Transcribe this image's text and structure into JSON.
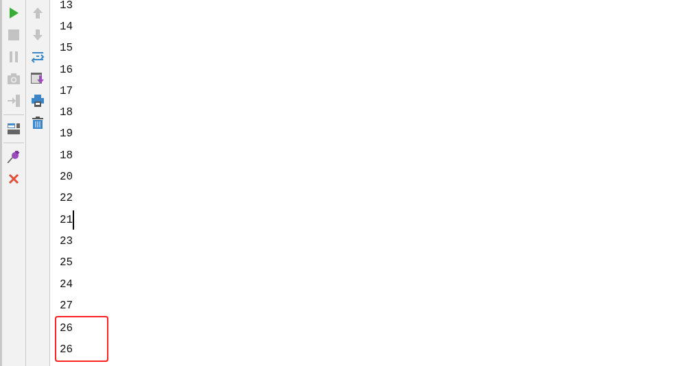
{
  "toolbar_left": [
    {
      "kind": "run",
      "disabled": false
    },
    {
      "kind": "stop",
      "disabled": true
    },
    {
      "kind": "pause",
      "disabled": true
    },
    {
      "kind": "camera",
      "disabled": true
    },
    {
      "kind": "exit",
      "disabled": true
    },
    {
      "kind": "separator"
    },
    {
      "kind": "layout",
      "disabled": false
    },
    {
      "kind": "separator"
    },
    {
      "kind": "pin",
      "disabled": false
    },
    {
      "kind": "close",
      "disabled": false
    }
  ],
  "toolbar_right": [
    {
      "kind": "up",
      "disabled": true
    },
    {
      "kind": "down",
      "disabled": true
    },
    {
      "kind": "wrap",
      "disabled": false
    },
    {
      "kind": "scroll-end",
      "disabled": false
    },
    {
      "kind": "print",
      "disabled": false
    },
    {
      "kind": "trash",
      "disabled": false
    }
  ],
  "console_lines": [
    {
      "text": "13",
      "cursor": false,
      "highlighted": false
    },
    {
      "text": "14",
      "cursor": false,
      "highlighted": false
    },
    {
      "text": "15",
      "cursor": false,
      "highlighted": false
    },
    {
      "text": "16",
      "cursor": false,
      "highlighted": false
    },
    {
      "text": "17",
      "cursor": false,
      "highlighted": false
    },
    {
      "text": "18",
      "cursor": false,
      "highlighted": false
    },
    {
      "text": "19",
      "cursor": false,
      "highlighted": false
    },
    {
      "text": "18",
      "cursor": false,
      "highlighted": false
    },
    {
      "text": "20",
      "cursor": false,
      "highlighted": false
    },
    {
      "text": "22",
      "cursor": false,
      "highlighted": false
    },
    {
      "text": "21",
      "cursor": true,
      "highlighted": false
    },
    {
      "text": "23",
      "cursor": false,
      "highlighted": false
    },
    {
      "text": "25",
      "cursor": false,
      "highlighted": false
    },
    {
      "text": "24",
      "cursor": false,
      "highlighted": false
    },
    {
      "text": "27",
      "cursor": false,
      "highlighted": false
    },
    {
      "text": "26",
      "cursor": false,
      "highlighted": true
    },
    {
      "text": "26",
      "cursor": false,
      "highlighted": true
    }
  ]
}
